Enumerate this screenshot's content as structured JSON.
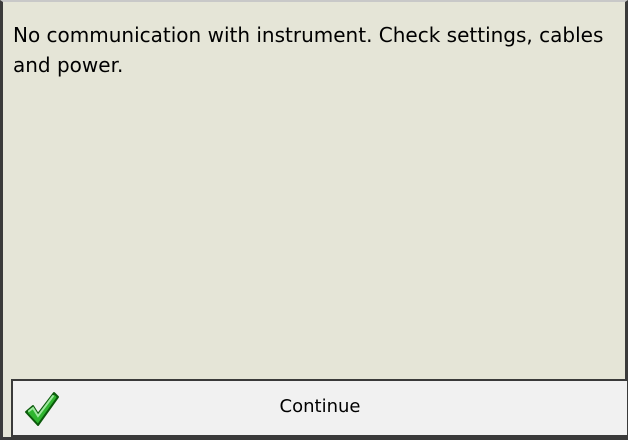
{
  "dialog": {
    "message": "No communication with instrument. Check settings, cables and power.",
    "button": {
      "label": "Continue",
      "icon": "checkmark-icon",
      "icon_color": "#2fb52f"
    }
  }
}
